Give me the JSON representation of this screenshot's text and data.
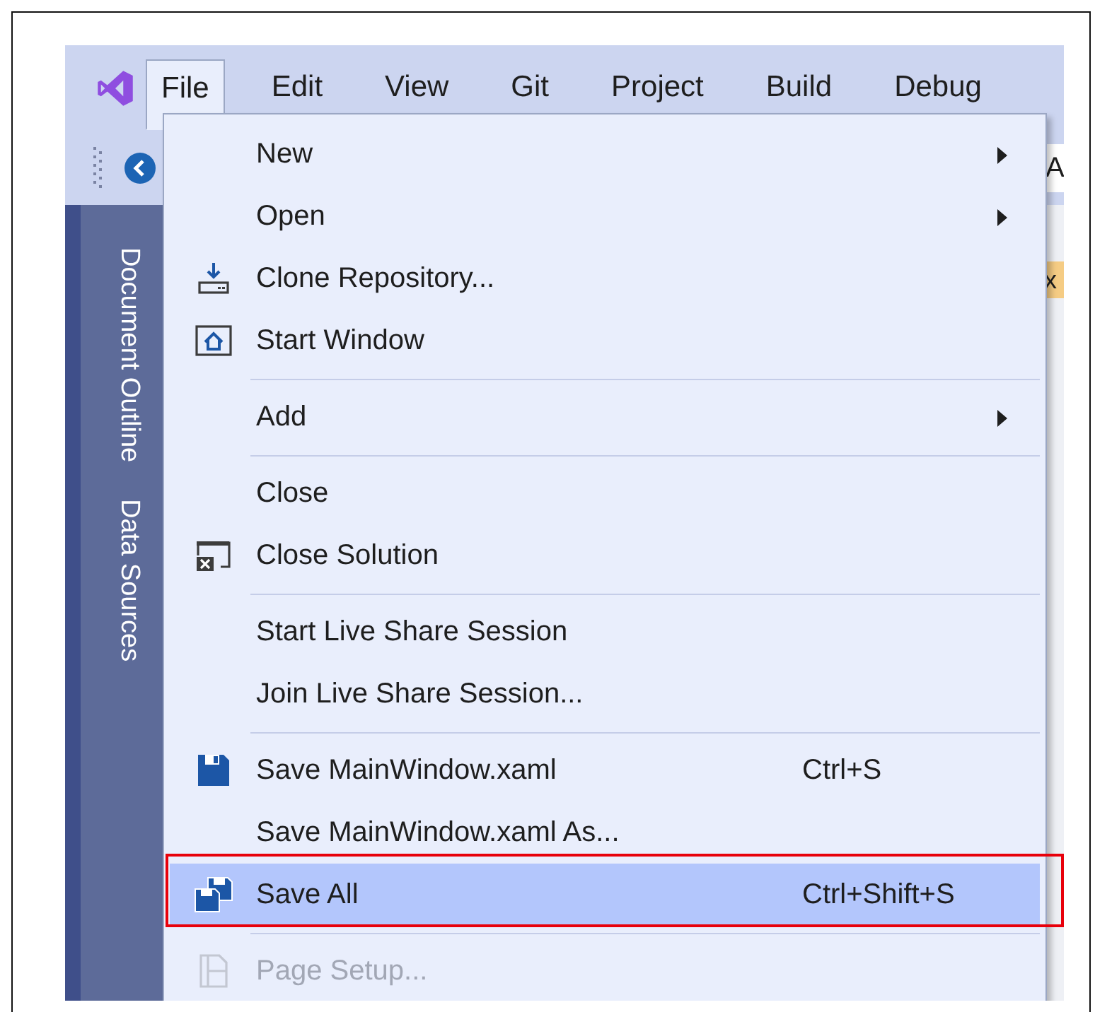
{
  "menu_bar": {
    "items": [
      {
        "label": "File",
        "selected": true
      },
      {
        "label": "Edit",
        "selected": false
      },
      {
        "label": "View",
        "selected": false
      },
      {
        "label": "Git",
        "selected": false
      },
      {
        "label": "Project",
        "selected": false
      },
      {
        "label": "Build",
        "selected": false
      },
      {
        "label": "Debug",
        "selected": false
      }
    ]
  },
  "toolbar": {
    "field_text": "A"
  },
  "document_tab": {
    "close_text": "x"
  },
  "side_tabs": [
    "Document Outline",
    "Data Sources"
  ],
  "file_menu": [
    {
      "kind": "item",
      "label": "New",
      "submenu": true,
      "icon": false,
      "disabled": false,
      "selected": false,
      "highlighted": false
    },
    {
      "kind": "item",
      "label": "Open",
      "submenu": true,
      "icon": false,
      "disabled": false,
      "selected": false,
      "highlighted": false
    },
    {
      "kind": "item",
      "label": "Clone Repository...",
      "submenu": false,
      "icon": true,
      "disabled": false,
      "selected": false,
      "highlighted": false
    },
    {
      "kind": "item",
      "label": "Start Window",
      "submenu": false,
      "icon": true,
      "disabled": false,
      "selected": false,
      "highlighted": false
    },
    {
      "kind": "separator"
    },
    {
      "kind": "item",
      "label": "Add",
      "submenu": true,
      "icon": false,
      "disabled": false,
      "selected": false,
      "highlighted": false
    },
    {
      "kind": "separator"
    },
    {
      "kind": "item",
      "label": "Close",
      "submenu": false,
      "icon": false,
      "disabled": false,
      "selected": false,
      "highlighted": false
    },
    {
      "kind": "item",
      "label": "Close Solution",
      "submenu": false,
      "icon": true,
      "disabled": false,
      "selected": false,
      "highlighted": false
    },
    {
      "kind": "separator"
    },
    {
      "kind": "item",
      "label": "Start Live Share Session",
      "submenu": false,
      "icon": false,
      "disabled": false,
      "selected": false,
      "highlighted": false
    },
    {
      "kind": "item",
      "label": "Join Live Share Session...",
      "submenu": false,
      "icon": false,
      "disabled": false,
      "selected": false,
      "highlighted": false
    },
    {
      "kind": "separator"
    },
    {
      "kind": "item",
      "label": "Save MainWindow.xaml",
      "shortcut": "Ctrl+S",
      "submenu": false,
      "icon": true,
      "disabled": false,
      "selected": false,
      "highlighted": false
    },
    {
      "kind": "item",
      "label": "Save MainWindow.xaml As...",
      "submenu": false,
      "icon": false,
      "disabled": false,
      "selected": false,
      "highlighted": false
    },
    {
      "kind": "item",
      "label": "Save All",
      "shortcut": "Ctrl+Shift+S",
      "submenu": false,
      "icon": true,
      "disabled": false,
      "selected": true,
      "highlighted": true
    },
    {
      "kind": "separator"
    },
    {
      "kind": "item",
      "label": "Page Setup...",
      "submenu": false,
      "icon": true,
      "disabled": true,
      "selected": false,
      "highlighted": false
    }
  ]
}
